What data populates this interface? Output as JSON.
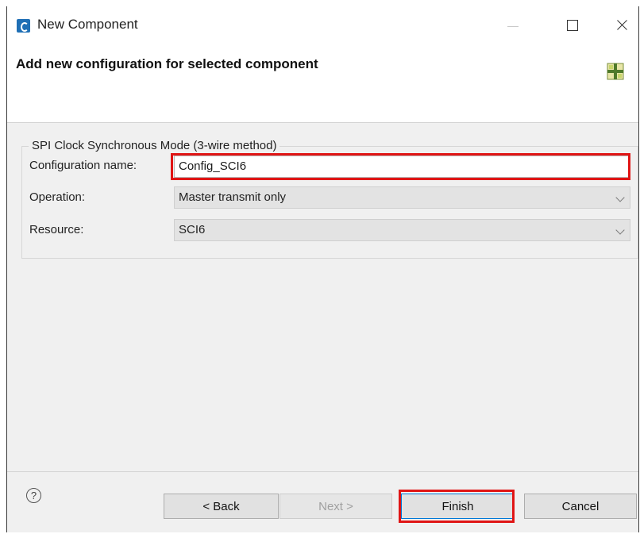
{
  "window": {
    "title": "New Component"
  },
  "header": {
    "title": "Add new configuration for selected component"
  },
  "group": {
    "title": "SPI Clock Synchronous Mode (3-wire method)",
    "config_name_label": "Configuration name:",
    "config_name_value": "Config_SCI6",
    "operation_label": "Operation:",
    "operation_value": "Master transmit only",
    "resource_label": "Resource:",
    "resource_value": "SCI6"
  },
  "footer": {
    "help_label": "?",
    "back_label": "< Back",
    "next_label": "Next >",
    "finish_label": "Finish",
    "cancel_label": "Cancel"
  },
  "colors": {
    "highlight": "#e01515",
    "focus": "#0078d7"
  },
  "icons": {
    "app": "app-icon",
    "wizard": "wizard-icon",
    "help": "help-icon",
    "dropdown": "chevron-down-icon"
  }
}
